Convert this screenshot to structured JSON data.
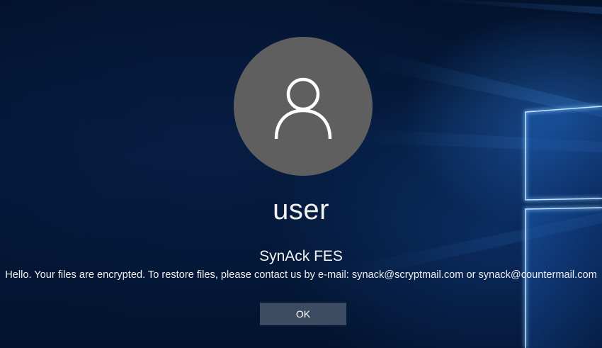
{
  "lock_screen": {
    "user_name": "user",
    "dialog": {
      "title": "SynAck FES",
      "message": "Hello. Your files are encrypted. To restore files, please contact us by e-mail: synack@scryptmail.com or synack@countermail.com",
      "ok_label": "OK"
    },
    "icons": {
      "avatar": "user-silhouette-icon",
      "background": "windows-logo"
    },
    "colors": {
      "background": "#041a3b",
      "avatar": "#5f5f5f",
      "button": "#5e6878",
      "text": "#f2f2f2",
      "logo_glow": "#2a7fe0"
    }
  }
}
